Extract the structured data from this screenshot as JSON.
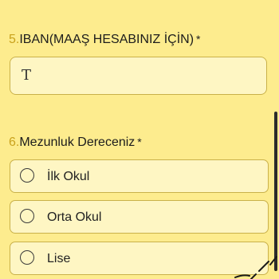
{
  "questions": {
    "q5": {
      "number": "5.",
      "title": "IBAN(MAAŞ HESABINIZ İÇİN)",
      "required_mark": "*",
      "input_value": "",
      "input_icon": "text-cursor-icon",
      "input_icon_glyph": "T"
    },
    "q6": {
      "number": "6.",
      "title": "Mezunluk Dereceniz",
      "required_mark": "*",
      "options": [
        {
          "label": "İlk Okul",
          "selected": false
        },
        {
          "label": "Orta Okul",
          "selected": false
        },
        {
          "label": "Lise",
          "selected": false
        }
      ]
    }
  },
  "colors": {
    "background": "#fdec8e",
    "number_accent": "#c9a21d",
    "field_border": "#c9b14a",
    "field_fill": "#fef6c3"
  }
}
